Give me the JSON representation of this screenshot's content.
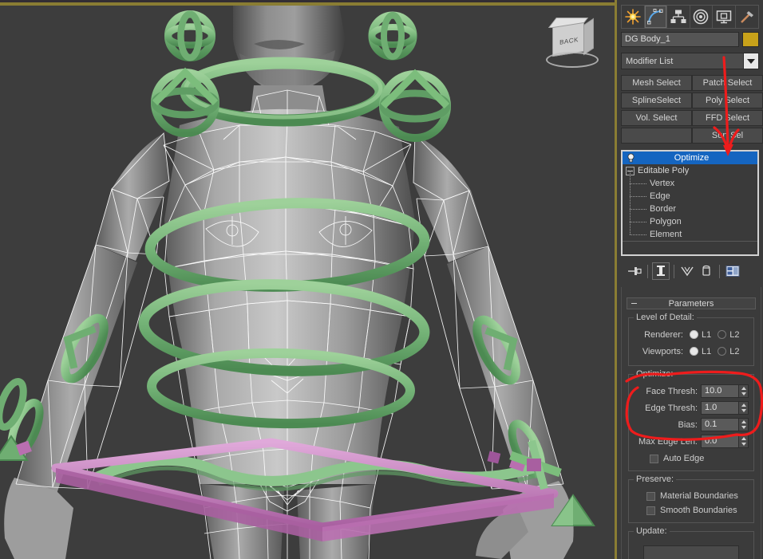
{
  "viewport": {
    "label": "",
    "viewcube_label": "BACK",
    "background_color": "#3d3d3d",
    "active_border_color": "#8a7d33",
    "rig_color_green": "#7cbd7c",
    "rig_color_pink": "#d18ac8",
    "wireframe_color": "#ffffff",
    "mesh_color": "#9a9a9a"
  },
  "command_panel": {
    "tabs": [
      {
        "name": "create-tab",
        "icon": "star-icon",
        "active": false
      },
      {
        "name": "modify-tab",
        "icon": "curve-icon",
        "active": true
      },
      {
        "name": "hierarchy-tab",
        "icon": "hierarchy-icon",
        "active": false
      },
      {
        "name": "motion-tab",
        "icon": "target-icon",
        "active": false
      },
      {
        "name": "display-tab",
        "icon": "monitor-icon",
        "active": false
      },
      {
        "name": "utilities-tab",
        "icon": "hammer-icon",
        "active": false
      }
    ],
    "object_name": "DG Body_1",
    "object_color": "#c8a21a",
    "modifier_list_label": "Modifier List",
    "modifier_buttons": [
      "Mesh Select",
      "Patch Select",
      "SplineSelect",
      "Poly Select",
      "Vol. Select",
      "FFD Select",
      "",
      "Surf Sel"
    ],
    "stack": {
      "items": [
        {
          "label": "Optimize",
          "selected": true,
          "type": "modifier"
        },
        {
          "label": "Editable Poly",
          "selected": false,
          "type": "base"
        }
      ],
      "sub_objects": [
        "Vertex",
        "Edge",
        "Border",
        "Polygon",
        "Element"
      ]
    },
    "stack_tools": [
      "pin-stack-icon",
      "show-end-result-icon",
      "make-unique-icon",
      "remove-modifier-icon",
      "configure-modifier-sets-icon"
    ]
  },
  "parameters": {
    "rollout_title": "Parameters",
    "level_of_detail": {
      "title": "Level of Detail:",
      "rows": [
        {
          "label": "Renderer:",
          "options": [
            "L1",
            "L2"
          ],
          "selected": "L1"
        },
        {
          "label": "Viewports:",
          "options": [
            "L1",
            "L2"
          ],
          "selected": "L1"
        }
      ]
    },
    "optimize": {
      "title": "Optimize:",
      "fields": [
        {
          "label": "Face Thresh:",
          "value": "10.0"
        },
        {
          "label": "Edge Thresh:",
          "value": "1.0"
        },
        {
          "label": "Bias:",
          "value": "0.1"
        },
        {
          "label": "Max Edge Len:",
          "value": "0.0"
        }
      ],
      "auto_edge": {
        "label": "Auto Edge",
        "checked": false
      }
    },
    "preserve": {
      "title": "Preserve:",
      "checkboxes": [
        {
          "label": "Material Boundaries",
          "checked": false
        },
        {
          "label": "Smooth Boundaries",
          "checked": false
        }
      ]
    },
    "update": {
      "title": "Update:"
    }
  },
  "annotations": {
    "arrow_color": "#ee1c1c",
    "items": [
      {
        "name": "arrow-to-optimize",
        "type": "arrow"
      },
      {
        "name": "highlight-thresholds",
        "type": "loop"
      }
    ]
  }
}
